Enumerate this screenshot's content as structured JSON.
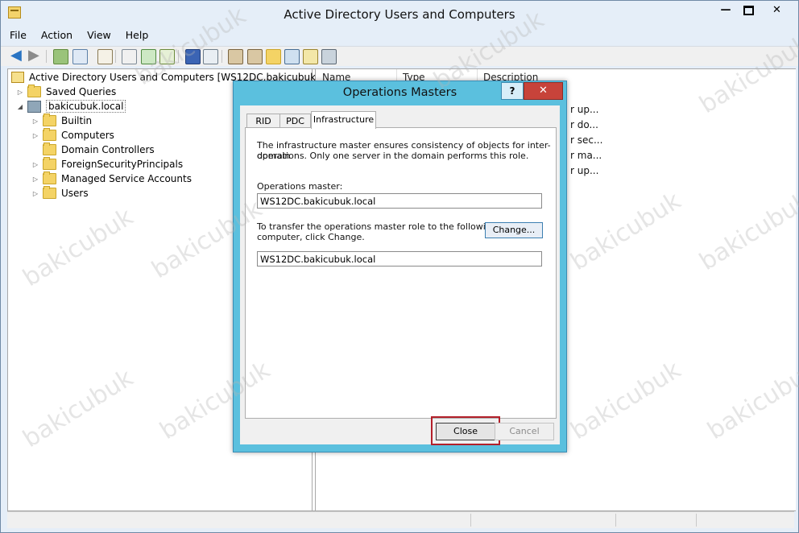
{
  "window": {
    "title": "Active Directory Users and Computers",
    "minimize_glyph": "—",
    "close_glyph": "✕"
  },
  "menu": [
    "File",
    "Action",
    "View",
    "Help"
  ],
  "tree": {
    "root": "Active Directory Users and Computers [WS12DC.bakicubuk.local]",
    "saved_queries": "Saved Queries",
    "domain": "bakicubuk.local",
    "children": [
      "Builtin",
      "Computers",
      "Domain Controllers",
      "ForeignSecurityPrincipals",
      "Managed Service Accounts",
      "Users"
    ]
  },
  "list": {
    "columns": [
      "Name",
      "Type",
      "Description"
    ],
    "descriptions_visible": [
      "r up...",
      "r do...",
      "r sec...",
      "r ma...",
      "r up..."
    ]
  },
  "dialog": {
    "title": "Operations Masters",
    "help": "?",
    "close": "✕",
    "tabs": [
      "RID",
      "PDC",
      "Infrastructure"
    ],
    "active_tab": "Infrastructure",
    "description_line1": "The infrastructure master ensures consistency of objects for inter-domain",
    "description_line2": "operations. Only one server in the domain performs this role.",
    "operations_master_label": "Operations master:",
    "operations_master_value": "WS12DC.bakicubuk.local",
    "transfer_line1": "To transfer the operations master role to the following",
    "transfer_line2": "computer, click Change.",
    "change_button": "Change...",
    "target_value": "WS12DC.bakicubuk.local",
    "close_button": "Close",
    "cancel_button": "Cancel"
  },
  "watermark": "bakicubuk",
  "colors": {
    "dialog_frame": "#5bc0de",
    "close_highlight": "#b3202a",
    "close_title_button": "#c7433a"
  }
}
